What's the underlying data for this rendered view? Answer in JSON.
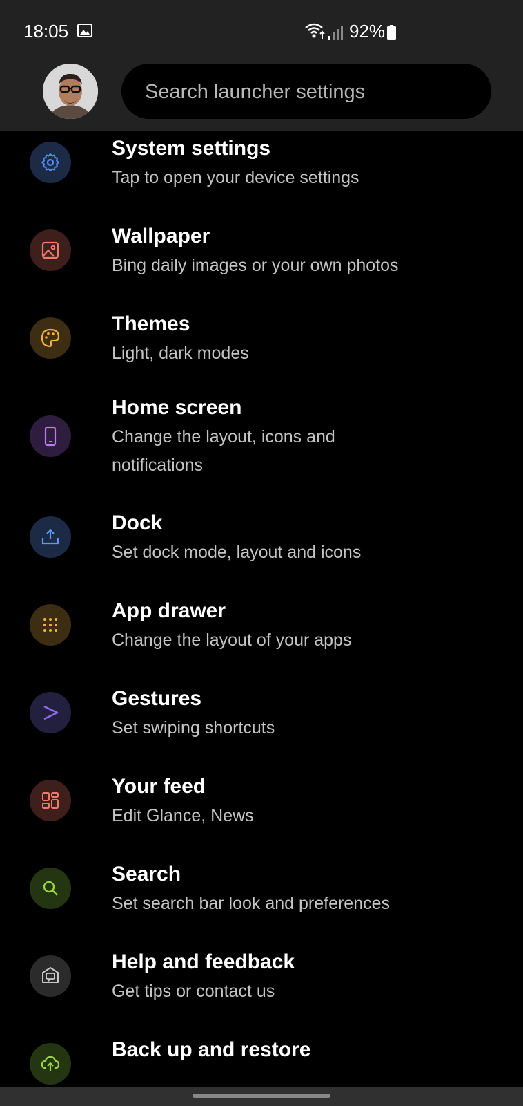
{
  "status_bar": {
    "time": "18:05",
    "battery": "92%",
    "icons": [
      "gallery-icon",
      "wifi-icon",
      "signal-icon",
      "battery-icon"
    ]
  },
  "header": {
    "search_placeholder": "Search launcher settings"
  },
  "items": [
    {
      "title": "System settings",
      "subtitle": "Tap to open your device settings",
      "icon": "gear-icon",
      "icon_bg": "#1c2a46",
      "icon_color": "#4f8ff7"
    },
    {
      "title": "Wallpaper",
      "subtitle": "Bing daily images or your own photos",
      "icon": "image-icon",
      "icon_bg": "#3f1f1c",
      "icon_color": "#f07a6a"
    },
    {
      "title": "Themes",
      "subtitle": "Light, dark modes",
      "icon": "palette-icon",
      "icon_bg": "#3d2d12",
      "icon_color": "#f4b23d"
    },
    {
      "title": "Home screen",
      "subtitle": "Change the layout, icons and notifications",
      "icon": "phone-icon",
      "icon_bg": "#2e1d3e",
      "icon_color": "#c07ae8"
    },
    {
      "title": "Dock",
      "subtitle": "Set dock mode, layout and icons",
      "icon": "dock-upload-icon",
      "icon_bg": "#1c2a46",
      "icon_color": "#5a9bf5"
    },
    {
      "title": "App drawer",
      "subtitle": "Change the layout of your apps",
      "icon": "grid-icon",
      "icon_bg": "#3d2d12",
      "icon_color": "#f4b23d"
    },
    {
      "title": "Gestures",
      "subtitle": "Set swiping shortcuts",
      "icon": "gesture-icon",
      "icon_bg": "#23203f",
      "icon_color": "#8d6cf5"
    },
    {
      "title": "Your feed",
      "subtitle": "Edit Glance, News",
      "icon": "feed-icon",
      "icon_bg": "#3f1f1c",
      "icon_color": "#f07a6a"
    },
    {
      "title": "Search",
      "subtitle": "Set search bar look and preferences",
      "icon": "search-icon",
      "icon_bg": "#243512",
      "icon_color": "#9bd43f"
    },
    {
      "title": "Help and feedback",
      "subtitle": "Get tips or contact us",
      "icon": "help-icon",
      "icon_bg": "#2b2b2b",
      "icon_color": "#c8c8c8"
    },
    {
      "title": "Back up and restore",
      "subtitle": "",
      "icon": "cloud-upload-icon",
      "icon_bg": "#243512",
      "icon_color": "#9bd43f"
    }
  ]
}
